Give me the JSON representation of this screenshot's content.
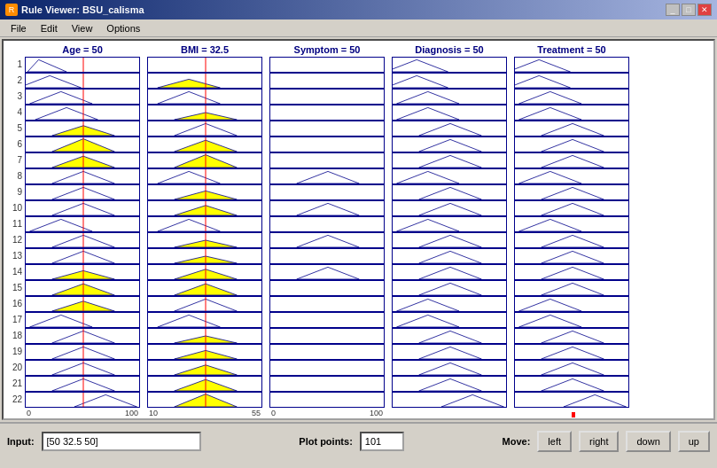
{
  "window": {
    "title": "Rule Viewer: BSU_calisma",
    "icon": "R"
  },
  "menu": {
    "items": [
      "File",
      "Edit",
      "View",
      "Options"
    ]
  },
  "columns": [
    {
      "label": "Age = 50",
      "range_start": "0",
      "range_end": "100",
      "red_line_pct": 0.5
    },
    {
      "label": "BMI = 32.5",
      "range_start": "10",
      "range_end": "55",
      "red_line_pct": 0.5
    },
    {
      "label": "Symptom = 50",
      "range_start": "0",
      "range_end": "100",
      "red_line_pct": 0.5
    },
    {
      "label": "Diagnosis = 50",
      "range_start": "",
      "range_end": "",
      "red_line_pct": 0.5
    },
    {
      "label": "Treatment = 50",
      "range_start": "",
      "range_end": "",
      "red_line_pct": 0.5
    }
  ],
  "rows": 22,
  "bottom": {
    "input_label": "Input:",
    "input_value": "[50 32.5 50]",
    "plot_label": "Plot points:",
    "plot_value": "101",
    "move_label": "Move:",
    "btn_left": "left",
    "btn_right": "right",
    "btn_down": "down",
    "btn_up": "up"
  }
}
